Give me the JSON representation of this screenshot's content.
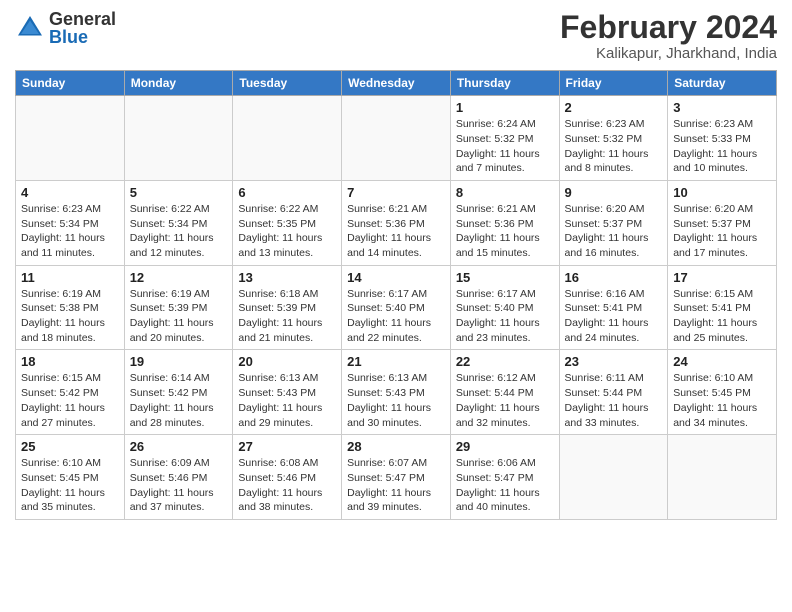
{
  "header": {
    "logo_general": "General",
    "logo_blue": "Blue",
    "title": "February 2024",
    "location": "Kalikapur, Jharkhand, India"
  },
  "days_of_week": [
    "Sunday",
    "Monday",
    "Tuesday",
    "Wednesday",
    "Thursday",
    "Friday",
    "Saturday"
  ],
  "weeks": [
    [
      {
        "day": "",
        "info": ""
      },
      {
        "day": "",
        "info": ""
      },
      {
        "day": "",
        "info": ""
      },
      {
        "day": "",
        "info": ""
      },
      {
        "day": "1",
        "info": "Sunrise: 6:24 AM\nSunset: 5:32 PM\nDaylight: 11 hours and 7 minutes."
      },
      {
        "day": "2",
        "info": "Sunrise: 6:23 AM\nSunset: 5:32 PM\nDaylight: 11 hours and 8 minutes."
      },
      {
        "day": "3",
        "info": "Sunrise: 6:23 AM\nSunset: 5:33 PM\nDaylight: 11 hours and 10 minutes."
      }
    ],
    [
      {
        "day": "4",
        "info": "Sunrise: 6:23 AM\nSunset: 5:34 PM\nDaylight: 11 hours and 11 minutes."
      },
      {
        "day": "5",
        "info": "Sunrise: 6:22 AM\nSunset: 5:34 PM\nDaylight: 11 hours and 12 minutes."
      },
      {
        "day": "6",
        "info": "Sunrise: 6:22 AM\nSunset: 5:35 PM\nDaylight: 11 hours and 13 minutes."
      },
      {
        "day": "7",
        "info": "Sunrise: 6:21 AM\nSunset: 5:36 PM\nDaylight: 11 hours and 14 minutes."
      },
      {
        "day": "8",
        "info": "Sunrise: 6:21 AM\nSunset: 5:36 PM\nDaylight: 11 hours and 15 minutes."
      },
      {
        "day": "9",
        "info": "Sunrise: 6:20 AM\nSunset: 5:37 PM\nDaylight: 11 hours and 16 minutes."
      },
      {
        "day": "10",
        "info": "Sunrise: 6:20 AM\nSunset: 5:37 PM\nDaylight: 11 hours and 17 minutes."
      }
    ],
    [
      {
        "day": "11",
        "info": "Sunrise: 6:19 AM\nSunset: 5:38 PM\nDaylight: 11 hours and 18 minutes."
      },
      {
        "day": "12",
        "info": "Sunrise: 6:19 AM\nSunset: 5:39 PM\nDaylight: 11 hours and 20 minutes."
      },
      {
        "day": "13",
        "info": "Sunrise: 6:18 AM\nSunset: 5:39 PM\nDaylight: 11 hours and 21 minutes."
      },
      {
        "day": "14",
        "info": "Sunrise: 6:17 AM\nSunset: 5:40 PM\nDaylight: 11 hours and 22 minutes."
      },
      {
        "day": "15",
        "info": "Sunrise: 6:17 AM\nSunset: 5:40 PM\nDaylight: 11 hours and 23 minutes."
      },
      {
        "day": "16",
        "info": "Sunrise: 6:16 AM\nSunset: 5:41 PM\nDaylight: 11 hours and 24 minutes."
      },
      {
        "day": "17",
        "info": "Sunrise: 6:15 AM\nSunset: 5:41 PM\nDaylight: 11 hours and 25 minutes."
      }
    ],
    [
      {
        "day": "18",
        "info": "Sunrise: 6:15 AM\nSunset: 5:42 PM\nDaylight: 11 hours and 27 minutes."
      },
      {
        "day": "19",
        "info": "Sunrise: 6:14 AM\nSunset: 5:42 PM\nDaylight: 11 hours and 28 minutes."
      },
      {
        "day": "20",
        "info": "Sunrise: 6:13 AM\nSunset: 5:43 PM\nDaylight: 11 hours and 29 minutes."
      },
      {
        "day": "21",
        "info": "Sunrise: 6:13 AM\nSunset: 5:43 PM\nDaylight: 11 hours and 30 minutes."
      },
      {
        "day": "22",
        "info": "Sunrise: 6:12 AM\nSunset: 5:44 PM\nDaylight: 11 hours and 32 minutes."
      },
      {
        "day": "23",
        "info": "Sunrise: 6:11 AM\nSunset: 5:44 PM\nDaylight: 11 hours and 33 minutes."
      },
      {
        "day": "24",
        "info": "Sunrise: 6:10 AM\nSunset: 5:45 PM\nDaylight: 11 hours and 34 minutes."
      }
    ],
    [
      {
        "day": "25",
        "info": "Sunrise: 6:10 AM\nSunset: 5:45 PM\nDaylight: 11 hours and 35 minutes."
      },
      {
        "day": "26",
        "info": "Sunrise: 6:09 AM\nSunset: 5:46 PM\nDaylight: 11 hours and 37 minutes."
      },
      {
        "day": "27",
        "info": "Sunrise: 6:08 AM\nSunset: 5:46 PM\nDaylight: 11 hours and 38 minutes."
      },
      {
        "day": "28",
        "info": "Sunrise: 6:07 AM\nSunset: 5:47 PM\nDaylight: 11 hours and 39 minutes."
      },
      {
        "day": "29",
        "info": "Sunrise: 6:06 AM\nSunset: 5:47 PM\nDaylight: 11 hours and 40 minutes."
      },
      {
        "day": "",
        "info": ""
      },
      {
        "day": "",
        "info": ""
      }
    ]
  ]
}
